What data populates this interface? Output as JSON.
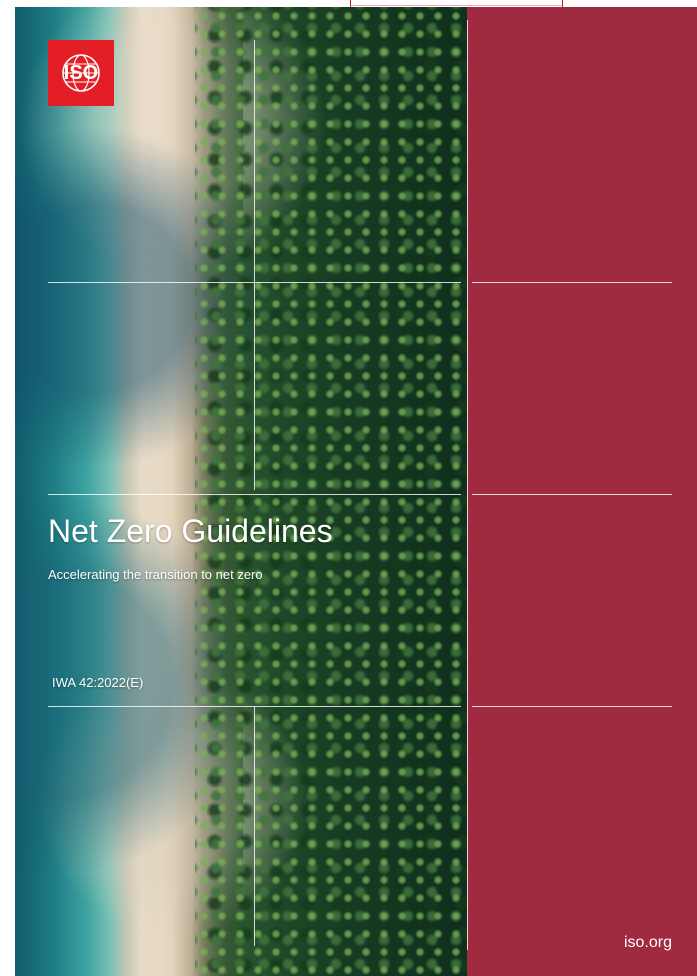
{
  "cover": {
    "logo_text": "ISO",
    "title": "Net Zero Guidelines",
    "subtitle": "Accelerating the transition to net zero",
    "document_number": "IWA 42:2022(E)",
    "website": "iso.org"
  },
  "colors": {
    "panel": "#a02a40",
    "logo": "#e31e24",
    "crop_marks": "#d21f2f"
  },
  "icons": {
    "logo": "iso-globe-icon"
  }
}
